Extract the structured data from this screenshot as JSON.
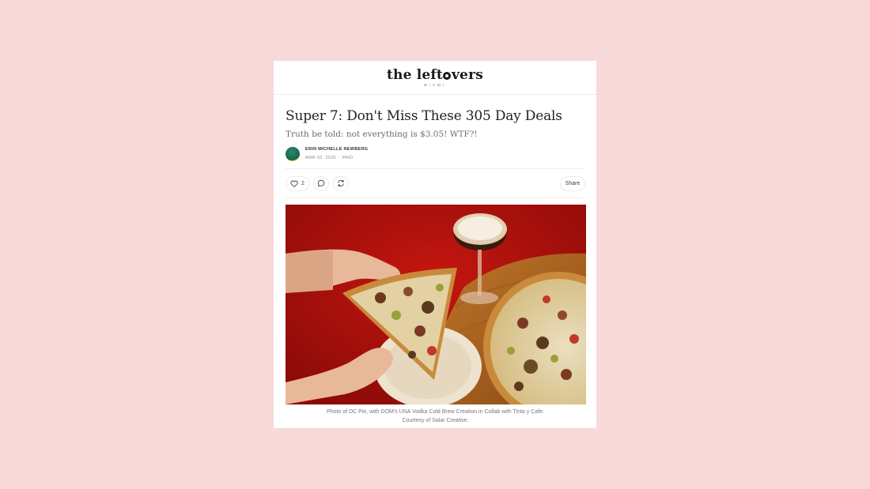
{
  "masthead": {
    "logo_part1": "the left",
    "logo_part2": "vers",
    "logo_sub": "MIAMI"
  },
  "post": {
    "title": "Super 7: Don't Miss These 305 Day Deals",
    "subtitle": "Truth be told: not everything is $3.05! WTF?!",
    "author": "ERIN MICHELLE NEWBERG",
    "date": "MAR 02, 2026",
    "dot": "∙",
    "access": "PAID"
  },
  "actions": {
    "like_count": "2",
    "share_label": "Share"
  },
  "photo": {
    "caption": "Photo of DC Pie, with DOM's UNA Vodka Cold Brew Creation in Collab with Tinta y Cafe. Courtesy of Salar Creative."
  },
  "icons": {
    "like": "heart-icon",
    "comment": "comment-icon",
    "restack": "restack-icon"
  },
  "colors": {
    "background": "#f7d9da",
    "card": "#ffffff",
    "photo_backdrop": "#b5100f",
    "table_wood": "#b0661e"
  }
}
